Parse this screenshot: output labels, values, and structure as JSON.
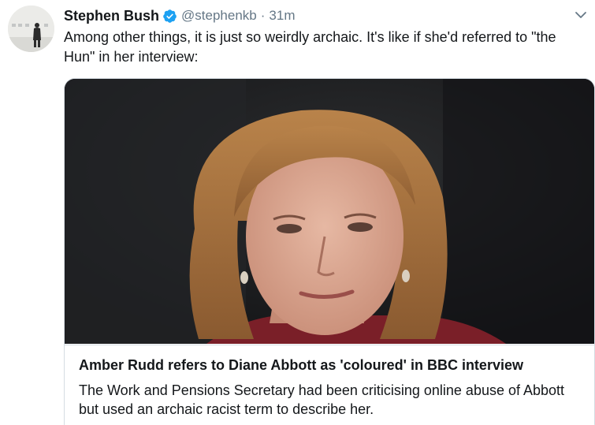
{
  "tweet": {
    "display_name": "Stephen Bush",
    "handle": "@stephenkb",
    "separator": "·",
    "timestamp": "31m",
    "text": "Among other things, it is just so weirdly archaic. It's like if she'd referred to \"the Hun\" in her interview:",
    "verified": true,
    "icons": {
      "avatar": "avatar-photo",
      "verified": "verified-badge-icon",
      "menu": "chevron-down-icon"
    }
  },
  "card": {
    "image_alt": "amber-rudd-photo",
    "title": "Amber Rudd refers to Diane Abbott as 'coloured' in BBC interview",
    "description": "The Work and Pensions Secretary had been criticising online abuse of Abbott but used an archaic racist term to describe her."
  },
  "colors": {
    "text_primary": "#14171a",
    "text_secondary": "#657786",
    "verified_blue": "#1da1f2",
    "border": "#d5dce2"
  }
}
